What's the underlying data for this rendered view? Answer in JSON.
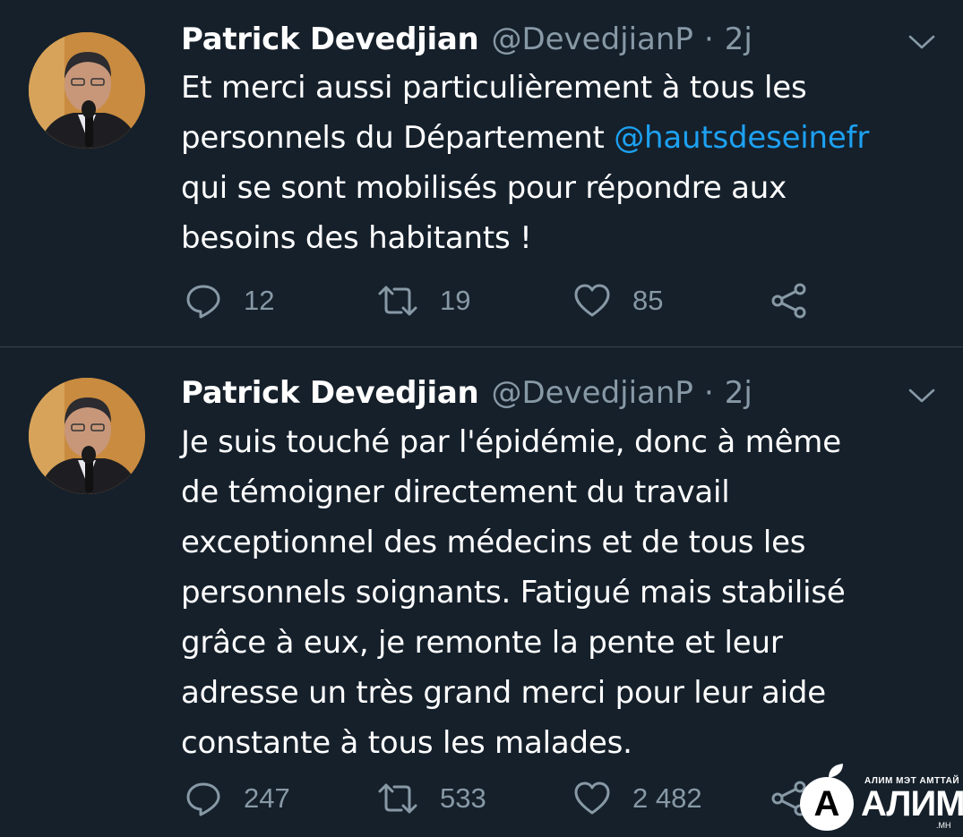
{
  "icons": {
    "reply": "reply-icon",
    "retweet": "retweet-icon",
    "like": "like-icon",
    "share": "share-icon",
    "caret": "chevron-down-icon"
  },
  "colors": {
    "background": "#15202b",
    "text": "#ffffff",
    "muted": "#8899a6",
    "mention": "#1da1f2",
    "divider": "#38444d"
  },
  "tweets": [
    {
      "author": {
        "name": "Patrick Devedjian",
        "handle": "@DevedjianP"
      },
      "separator": "·",
      "time": "2j",
      "lines": [
        "Et merci aussi particulièrement à tous les",
        "personnels du Département ",
        "qui se sont mobilisés pour répondre aux",
        "besoins des habitants !"
      ],
      "mention": "@hautsdeseinefr",
      "counts": {
        "replies": "12",
        "retweets": "19",
        "likes": "85"
      }
    },
    {
      "author": {
        "name": "Patrick Devedjian",
        "handle": "@DevedjianP"
      },
      "separator": "·",
      "time": "2j",
      "lines": [
        "Je suis touché par l'épidémie, donc à même",
        "de témoigner directement du travail",
        "exceptionnel des médecins et de tous les",
        "personnels soignants. Fatigué mais stabilisé",
        "grâce à eux, je remonte la pente et leur",
        "adresse un très grand merci pour leur aide",
        "constante à tous les malades."
      ],
      "counts": {
        "replies": "247",
        "retweets": "533",
        "likes": "2 482"
      }
    }
  ],
  "watermark": {
    "letter": "A",
    "tagline": "АЛИМ МЭТ АМТТАЙ",
    "name": "АЛИМ",
    "domain": ".МН"
  }
}
